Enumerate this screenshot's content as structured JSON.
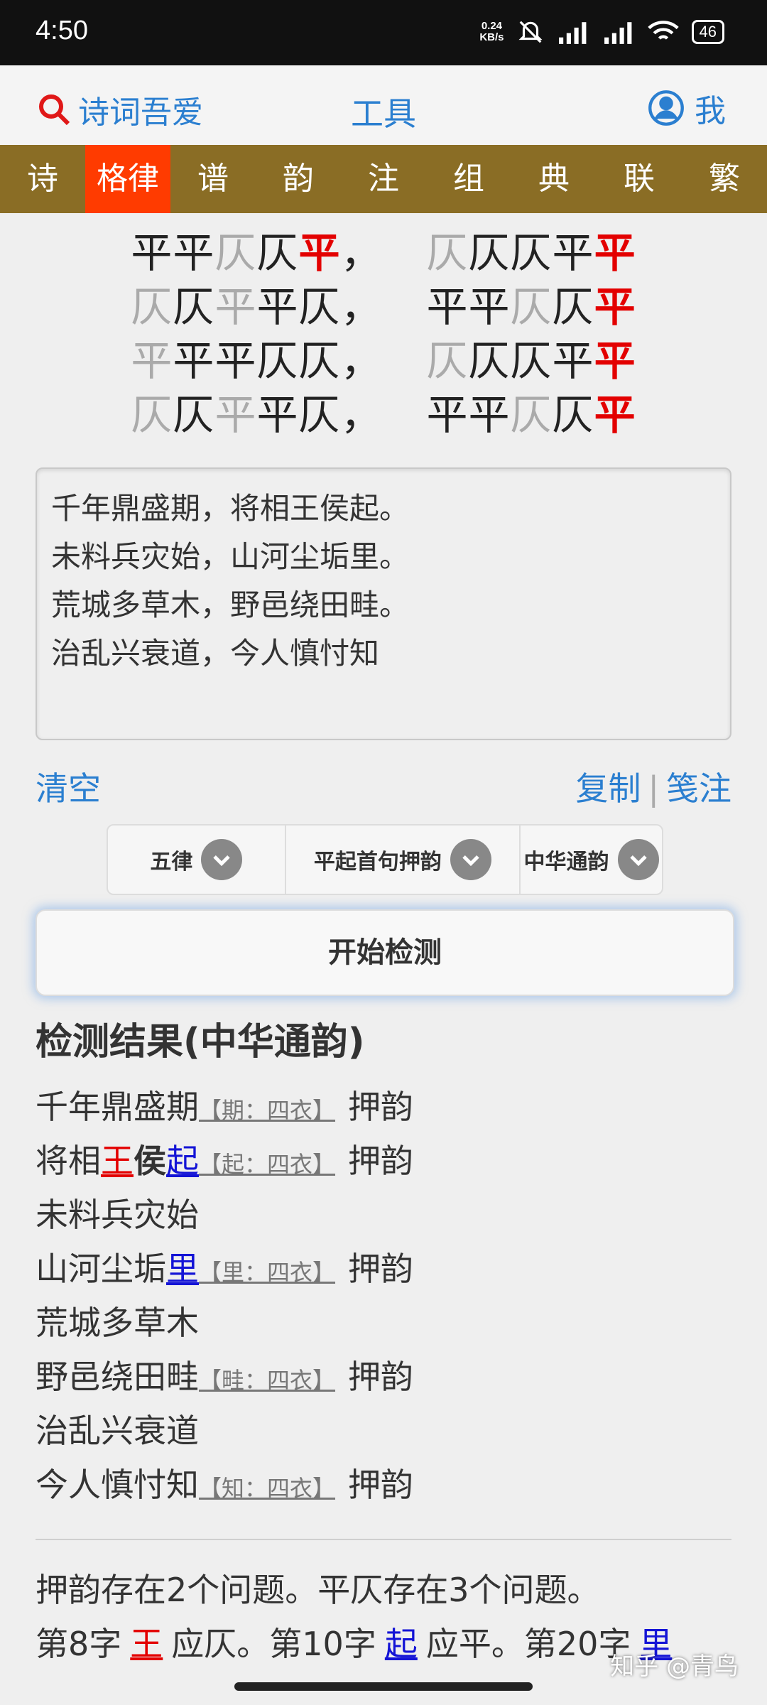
{
  "status": {
    "time": "4:50",
    "net_speed_value": "0.24",
    "net_speed_unit": "KB/s",
    "battery": "46"
  },
  "header": {
    "brand": "诗词吾爱",
    "title": "工具",
    "me": "我"
  },
  "nav": {
    "tabs": [
      {
        "label": "诗"
      },
      {
        "label": "格律",
        "active": true
      },
      {
        "label": "谱"
      },
      {
        "label": "韵"
      },
      {
        "label": "注"
      },
      {
        "label": "组"
      },
      {
        "label": "典"
      },
      {
        "label": "联"
      },
      {
        "label": "繁"
      }
    ]
  },
  "pattern": {
    "rows": [
      {
        "a": [
          [
            "平",
            "black"
          ],
          [
            "平",
            "black"
          ],
          [
            "仄",
            "gray"
          ],
          [
            "仄",
            "black"
          ],
          [
            "平",
            "red"
          ]
        ],
        "sep": "，",
        "b": [
          [
            "仄",
            "gray"
          ],
          [
            "仄",
            "black"
          ],
          [
            "仄",
            "black"
          ],
          [
            "平",
            "black"
          ],
          [
            "平",
            "red"
          ]
        ]
      },
      {
        "a": [
          [
            "仄",
            "gray"
          ],
          [
            "仄",
            "black"
          ],
          [
            "平",
            "gray"
          ],
          [
            "平",
            "black"
          ],
          [
            "仄",
            "black"
          ]
        ],
        "sep": "，",
        "b": [
          [
            "平",
            "black"
          ],
          [
            "平",
            "black"
          ],
          [
            "仄",
            "gray"
          ],
          [
            "仄",
            "black"
          ],
          [
            "平",
            "red"
          ]
        ]
      },
      {
        "a": [
          [
            "平",
            "gray"
          ],
          [
            "平",
            "black"
          ],
          [
            "平",
            "black"
          ],
          [
            "仄",
            "black"
          ],
          [
            "仄",
            "black"
          ]
        ],
        "sep": "，",
        "b": [
          [
            "仄",
            "gray"
          ],
          [
            "仄",
            "black"
          ],
          [
            "仄",
            "black"
          ],
          [
            "平",
            "black"
          ],
          [
            "平",
            "red"
          ]
        ]
      },
      {
        "a": [
          [
            "仄",
            "gray"
          ],
          [
            "仄",
            "black"
          ],
          [
            "平",
            "gray"
          ],
          [
            "平",
            "black"
          ],
          [
            "仄",
            "black"
          ]
        ],
        "sep": "，",
        "b": [
          [
            "平",
            "black"
          ],
          [
            "平",
            "black"
          ],
          [
            "仄",
            "gray"
          ],
          [
            "仄",
            "black"
          ],
          [
            "平",
            "red"
          ]
        ]
      }
    ]
  },
  "editor": {
    "lines": [
      "千年鼎盛期，将相王侯起。",
      "未料兵灾始，山河尘垢里。",
      "荒城多草木，野邑绕田畦。",
      "治乱兴衰道，今人慎忖知"
    ]
  },
  "actions": {
    "clear": "清空",
    "copy": "复制",
    "sep": "|",
    "annotate": "笺注"
  },
  "selects": {
    "form": "五律",
    "start": "平起首句押韵",
    "rhyme_book": "中华通韵"
  },
  "start_button": "开始检测",
  "result_title": "检测结果(中华通韵)",
  "results": [
    {
      "chars": [
        [
          "千",
          ""
        ],
        [
          "年",
          ""
        ],
        [
          "鼎",
          ""
        ],
        [
          "盛",
          ""
        ],
        [
          "期",
          ""
        ]
      ],
      "rhyme": "【期：四衣】",
      "tag": "押韵"
    },
    {
      "chars": [
        [
          "将",
          ""
        ],
        [
          "相",
          ""
        ],
        [
          "王",
          "red"
        ],
        [
          "侯",
          "bold"
        ],
        [
          "起",
          "blue"
        ]
      ],
      "rhyme": "【起：四衣】",
      "tag": "押韵"
    },
    {
      "chars": [
        [
          "未",
          ""
        ],
        [
          "料",
          ""
        ],
        [
          "兵",
          ""
        ],
        [
          "灾",
          ""
        ],
        [
          "始",
          ""
        ]
      ],
      "rhyme": "",
      "tag": ""
    },
    {
      "chars": [
        [
          "山",
          ""
        ],
        [
          "河",
          ""
        ],
        [
          "尘",
          ""
        ],
        [
          "垢",
          ""
        ],
        [
          "里",
          "blue"
        ]
      ],
      "rhyme": "【里：四衣】",
      "tag": "押韵"
    },
    {
      "chars": [
        [
          "荒",
          ""
        ],
        [
          "城",
          ""
        ],
        [
          "多",
          ""
        ],
        [
          "草",
          ""
        ],
        [
          "木",
          ""
        ]
      ],
      "rhyme": "",
      "tag": ""
    },
    {
      "chars": [
        [
          "野",
          ""
        ],
        [
          "邑",
          ""
        ],
        [
          "绕",
          ""
        ],
        [
          "田",
          ""
        ],
        [
          "畦",
          ""
        ]
      ],
      "rhyme": "【畦：四衣】",
      "tag": "押韵"
    },
    {
      "chars": [
        [
          "治",
          ""
        ],
        [
          "乱",
          ""
        ],
        [
          "兴",
          ""
        ],
        [
          "衰",
          ""
        ],
        [
          "道",
          ""
        ]
      ],
      "rhyme": "",
      "tag": ""
    },
    {
      "chars": [
        [
          "今",
          ""
        ],
        [
          "人",
          ""
        ],
        [
          "慎",
          ""
        ],
        [
          "忖",
          ""
        ],
        [
          "知",
          ""
        ]
      ],
      "rhyme": "【知：四衣】",
      "tag": "押韵"
    }
  ],
  "summary": {
    "line1": "押韵存在2个问题。平仄存在3个问题。",
    "p1_pre": "第8字",
    "p1_char": "王",
    "p1_post": "应仄。",
    "p2_pre": "第10字",
    "p2_char": "起",
    "p2_post": "应平。",
    "p3_pre": "第20字",
    "p3_char": "里"
  },
  "watermark": "知乎 @青鸟",
  "colors": {
    "brand_blue": "#2b7fd0",
    "nav_brown": "#8a6d25",
    "nav_active": "#ff3b00",
    "accent_red": "#e30000",
    "link_blue": "#1414d6"
  }
}
